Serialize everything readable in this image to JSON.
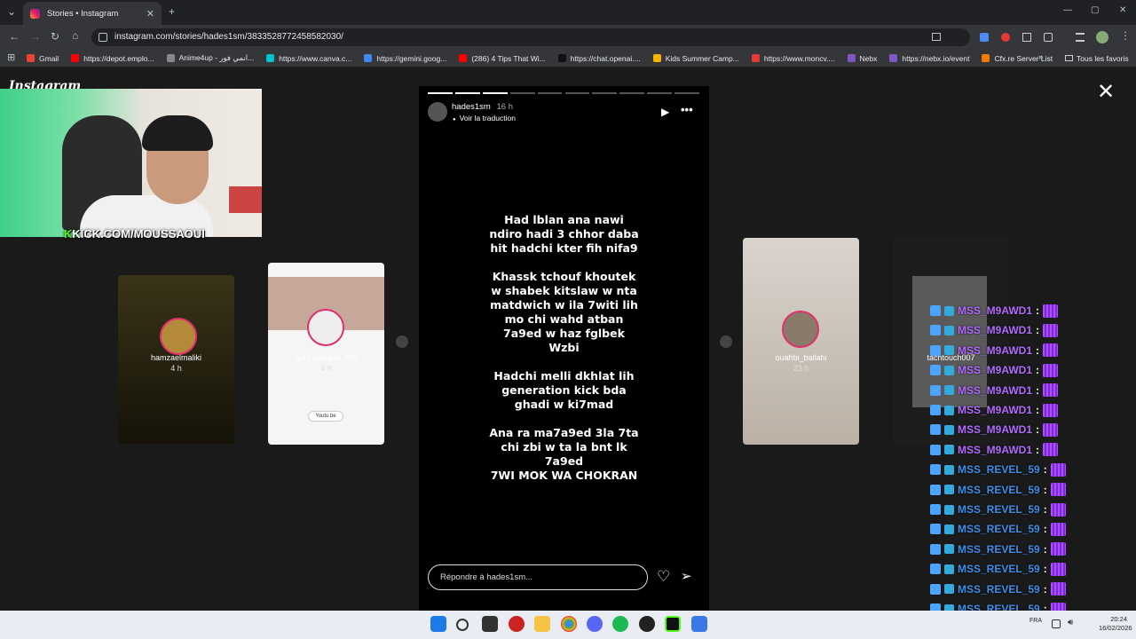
{
  "browser": {
    "tab_title": "Stories • Instagram",
    "tab_close": "✕",
    "new_tab": "+",
    "url": "instagram.com/stories/hades1sm/3833528772458582030/",
    "window_controls": [
      "—",
      "▢",
      "✕"
    ],
    "bookmarks": [
      {
        "label": "Gmail",
        "color": "#ea4335"
      },
      {
        "label": "https://depot.emplo...",
        "color": "#ff0000"
      },
      {
        "label": "Anime4up - انمي فور...",
        "color": "#888888"
      },
      {
        "label": "https://www.canva.c...",
        "color": "#00c4cc"
      },
      {
        "label": "https://gemini.goog...",
        "color": "#4285f4"
      },
      {
        "label": "(286) 4 Tips That Wi...",
        "color": "#ff0000"
      },
      {
        "label": "https://chat.openai....",
        "color": "#111111"
      },
      {
        "label": "Kids Summer Camp...",
        "color": "#f4b400"
      },
      {
        "label": "https://www.moncv....",
        "color": "#e53935"
      },
      {
        "label": "Nebx",
        "color": "#7e57c2"
      },
      {
        "label": "https://nebx.io/event",
        "color": "#7e57c2"
      },
      {
        "label": "Cfx.re Server List",
        "color": "#f57c00"
      }
    ],
    "all_bookmarks": "Tous les favoris"
  },
  "instagram": {
    "logo": "Instagram",
    "close": "✕"
  },
  "overlay": {
    "kick_prefix": "K",
    "kick_url": "KICK.COM/MOUSSAOUI"
  },
  "side_stories": [
    {
      "name": "hamzaelmaliki",
      "time": "4 h"
    },
    {
      "name": "ilyas_elmaliki_921",
      "time": "4 h"
    },
    {
      "name": "ouahbi_ballahi",
      "time": "23 h"
    },
    {
      "name": "tachtouch007",
      "time": ""
    }
  ],
  "story": {
    "username": "hades1sm",
    "time": "16 h",
    "translate": "Voir la traduction",
    "paragraphs": [
      "Had lblan ana nawi\nndiro hadi 3 chhor daba\nhit hadchi kter fih nifa9",
      "Khassk tchouf khoutek\nw shabek kitslaw w nta\nmatdwich w ila 7witi lih\nmo chi wahd atban\n7a9ed w haz fglbek\nWzbi",
      "Hadchi melli dkhlat lih\ngeneration kick bda\nghadi w ki7mad",
      "Ana ra ma7a9ed 3la 7ta\nchi zbi w ta la bnt lk\n7a9ed\n7WI MOK WA CHOKRAN"
    ],
    "reply_placeholder": "Répondre à hades1sm...",
    "segments_total": 10,
    "segments_done": 3
  },
  "chat": [
    {
      "name": "MSS_M9AWD1",
      "color": "#b26bff"
    },
    {
      "name": "MSS_M9AWD1",
      "color": "#b26bff"
    },
    {
      "name": "MSS_M9AWD1",
      "color": "#b26bff"
    },
    {
      "name": "MSS_M9AWD1",
      "color": "#b26bff"
    },
    {
      "name": "MSS_M9AWD1",
      "color": "#b26bff"
    },
    {
      "name": "MSS_M9AWD1",
      "color": "#b26bff"
    },
    {
      "name": "MSS_M9AWD1",
      "color": "#b26bff"
    },
    {
      "name": "MSS_M9AWD1",
      "color": "#b26bff"
    },
    {
      "name": "MSS_REVEL_59",
      "color": "#3e8ee8"
    },
    {
      "name": "MSS_REVEL_59",
      "color": "#3e8ee8"
    },
    {
      "name": "MSS_REVEL_59",
      "color": "#3e8ee8"
    },
    {
      "name": "MSS_REVEL_59",
      "color": "#3e8ee8"
    },
    {
      "name": "MSS_REVEL_59",
      "color": "#3e8ee8"
    },
    {
      "name": "MSS_REVEL_59",
      "color": "#3e8ee8"
    },
    {
      "name": "MSS_REVEL_59",
      "color": "#3e8ee8"
    },
    {
      "name": "MSS_REVEL_59",
      "color": "#3e8ee8"
    },
    {
      "name": "MSS_REVEL_59",
      "color": "#3e8ee8"
    }
  ],
  "chat_sep": ":",
  "taskbar": {
    "lang": "FRA",
    "time": "20:24",
    "date": "16/02/2026"
  }
}
